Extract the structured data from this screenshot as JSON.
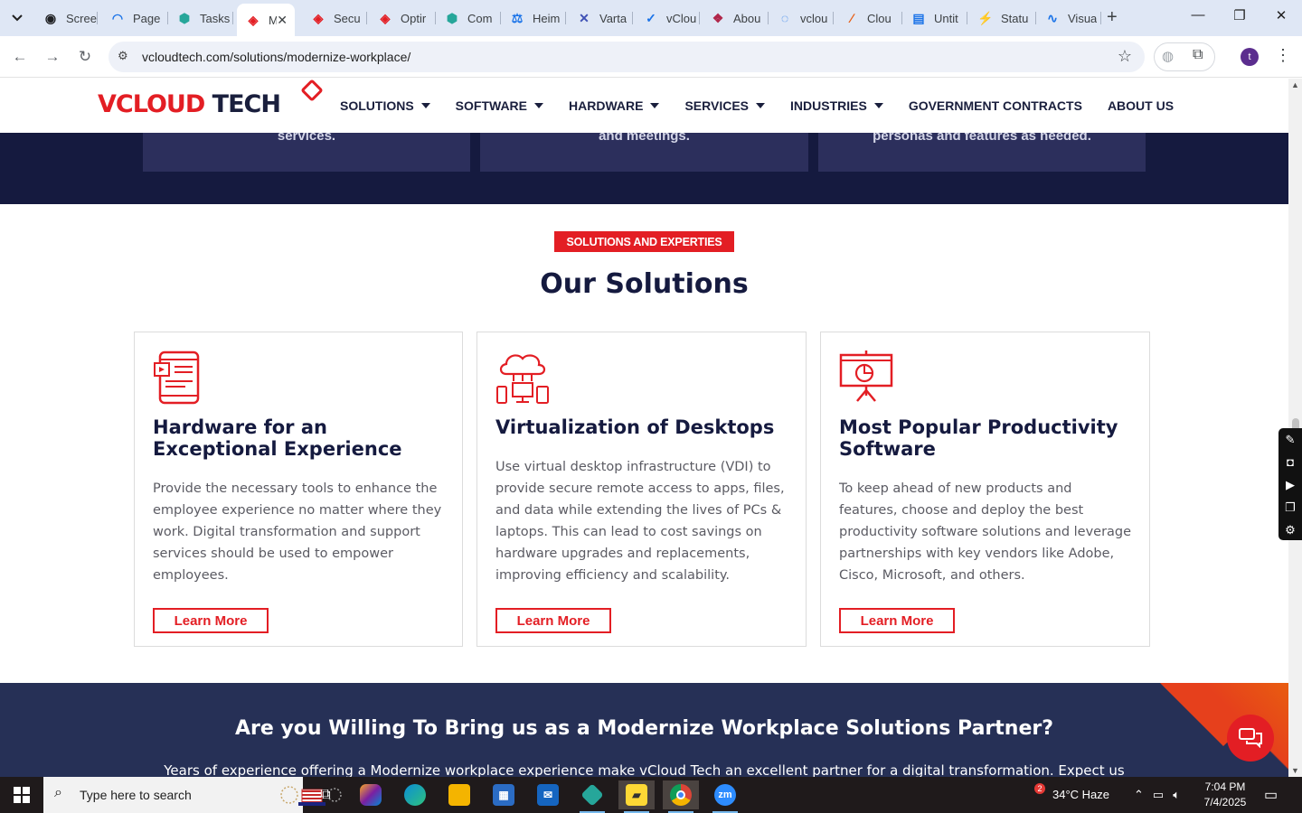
{
  "browser": {
    "tabs": [
      {
        "title": "Scree",
        "color": "#202124",
        "glyph": "◉"
      },
      {
        "title": "Page",
        "color": "#1a73e8",
        "glyph": "◠"
      },
      {
        "title": "Tasks",
        "color": "#26a69a",
        "glyph": "⬢"
      },
      {
        "title": "M",
        "color": "#e31e24",
        "glyph": "◈",
        "active": true
      },
      {
        "title": "Secu",
        "color": "#e31e24",
        "glyph": "◈"
      },
      {
        "title": "Optir",
        "color": "#e31e24",
        "glyph": "◈"
      },
      {
        "title": "Com",
        "color": "#26a69a",
        "glyph": "⬢"
      },
      {
        "title": "Heim",
        "color": "#1a73e8",
        "glyph": "⚖"
      },
      {
        "title": "Varta",
        "color": "#3f51b5",
        "glyph": "✕"
      },
      {
        "title": "vClou",
        "color": "#1a73e8",
        "glyph": "✓"
      },
      {
        "title": "Abou",
        "color": "#b0264a",
        "glyph": "❖"
      },
      {
        "title": "vclou",
        "color": "#1a73e8",
        "glyph": "◌"
      },
      {
        "title": "Clou",
        "color": "#e8590c",
        "glyph": "∕"
      },
      {
        "title": "Untit",
        "color": "#1a73e8",
        "glyph": "▤"
      },
      {
        "title": "Statu",
        "color": "#e91e63",
        "glyph": "⚡"
      },
      {
        "title": "Visua",
        "color": "#1a73e8",
        "glyph": "∿"
      }
    ],
    "new_tab": "+",
    "url": "vcloudtech.com/solutions/modernize-workplace/",
    "profile_initial": "t"
  },
  "site": {
    "logo": {
      "v": "V",
      "cloud": "CLOUD",
      "tech": " TECH"
    },
    "nav": [
      {
        "label": "SOLUTIONS",
        "dropdown": true
      },
      {
        "label": "SOFTWARE",
        "dropdown": true
      },
      {
        "label": "HARDWARE",
        "dropdown": true
      },
      {
        "label": "SERVICES",
        "dropdown": true
      },
      {
        "label": "INDUSTRIES",
        "dropdown": true
      },
      {
        "label": "GOVERNMENT CONTRACTS",
        "dropdown": false
      },
      {
        "label": "ABOUT US",
        "dropdown": false
      }
    ],
    "band_cards": [
      "services.",
      "and meetings.",
      "personas and features as needed."
    ],
    "badge": "SOLUTIONS AND EXPERTIES",
    "section_title": "Our Solutions",
    "cards": [
      {
        "title": "Hardware for an Exceptional Experience",
        "body": "Provide the necessary tools to enhance the employee experience no matter where they work. Digital transformation and support services should be used to empower employees.",
        "button": "Learn More",
        "icon": "tablet-icon"
      },
      {
        "title": "Virtualization of Desktops",
        "body": "Use virtual desktop infrastructure (VDI) to provide secure remote access to apps, files, and data while extending the lives of PCs & laptops. This can lead to cost savings on hardware upgrades and replacements, improving efficiency and scalability.",
        "button": "Learn More",
        "icon": "cloud-devices-icon"
      },
      {
        "title": "Most Popular Productivity Software",
        "body": "To keep ahead of new products and features, choose and deploy the best productivity software solutions and leverage partnerships with key vendors like Adobe, Cisco, Microsoft, and others.",
        "button": "Learn More",
        "icon": "presentation-board-icon"
      }
    ],
    "cta": {
      "title": "Are you Willing To Bring us as a Modernize Workplace Solutions Partner?",
      "subtitle": "Years of experience offering a Modernize workplace experience make vCloud Tech an excellent partner for a digital transformation. Expect us"
    }
  },
  "taskbar": {
    "search_placeholder": "Type here to search",
    "weather_badge": "2",
    "weather": "34°C  Haze",
    "time": "7:04 PM",
    "date": "7/4/2025"
  },
  "colors": {
    "brand_red": "#e31e24",
    "navy": "#151a3f",
    "cta_bg": "#263056"
  }
}
